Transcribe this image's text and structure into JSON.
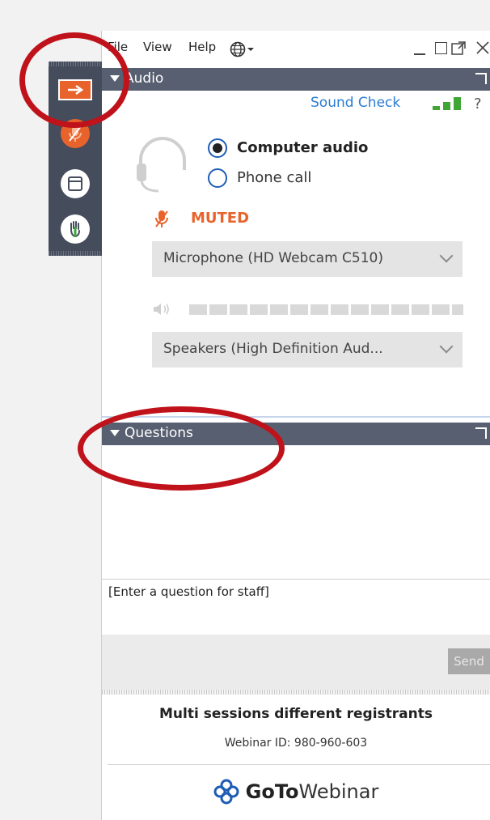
{
  "menubar": {
    "items": [
      "File",
      "View",
      "Help"
    ]
  },
  "audio_panel": {
    "title": "Audio",
    "sound_check": "Sound Check",
    "help": "?",
    "computer_audio": "Computer audio",
    "phone_call": "Phone call",
    "selected_option": "Computer audio",
    "mute_status": "MUTED",
    "microphone": "Microphone (HD Webcam C510)",
    "speakers": "Speakers (High Definition Aud...",
    "speaker_level": 0
  },
  "questions_panel": {
    "title": "Questions",
    "input_placeholder": "[Enter a question for staff]",
    "send_label": "Send"
  },
  "footer": {
    "session_title": "Multi sessions different registrants",
    "webinar_id": "Webinar ID: 980-960-603",
    "brand_bold": "GoTo",
    "brand_light": "Webinar"
  },
  "colors": {
    "panel_header": "#585f70",
    "sidebar": "#454c5c",
    "accent_orange": "#e8632b",
    "link_blue": "#2b7cd3",
    "signal_green": "#3fa535",
    "annotation_red": "#c0121a",
    "brand_blue": "#1f5db5"
  },
  "icons": [
    "arrow-right-icon",
    "microphone-off-icon",
    "window-icon",
    "raise-hand-icon",
    "globe-icon",
    "headset-icon",
    "speaker-icon",
    "signal-bars-icon",
    "gotowebinar-logo-icon"
  ]
}
